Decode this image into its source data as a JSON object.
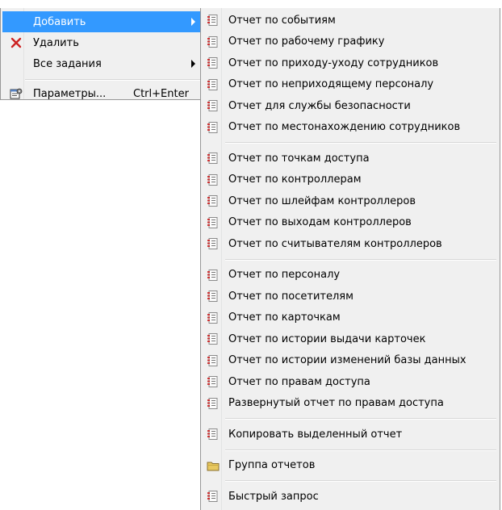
{
  "main_menu": {
    "items": [
      {
        "label": "Добавить",
        "shortcut": "",
        "has_submenu": true,
        "highlighted": true,
        "icon": ""
      },
      {
        "label": "Удалить",
        "shortcut": "",
        "has_submenu": false,
        "highlighted": false,
        "icon": "delete-x-icon"
      },
      {
        "label": "Все задания",
        "shortcut": "",
        "has_submenu": true,
        "highlighted": false,
        "icon": ""
      },
      {
        "label": "Параметры...",
        "shortcut": "Ctrl+Enter",
        "has_submenu": false,
        "highlighted": false,
        "icon": "properties-icon"
      }
    ]
  },
  "submenu": {
    "groups": [
      {
        "items": [
          {
            "label": "Отчет по событиям",
            "icon": "report-icon"
          },
          {
            "label": "Отчет по рабочему графику",
            "icon": "report-icon"
          },
          {
            "label": "Отчет по приходу-уходу сотрудников",
            "icon": "report-icon"
          },
          {
            "label": "Отчет по неприходящему персоналу",
            "icon": "report-icon"
          },
          {
            "label": "Отчет для службы безопасности",
            "icon": "report-icon"
          },
          {
            "label": "Отчет по местонахождению сотрудников",
            "icon": "report-icon"
          }
        ]
      },
      {
        "items": [
          {
            "label": "Отчет по точкам доступа",
            "icon": "report-icon"
          },
          {
            "label": "Отчет по контроллерам",
            "icon": "report-icon"
          },
          {
            "label": "Отчет по шлейфам контроллеров",
            "icon": "report-icon"
          },
          {
            "label": "Отчет по выходам контроллеров",
            "icon": "report-icon"
          },
          {
            "label": "Отчет по считывателям контроллеров",
            "icon": "report-icon"
          }
        ]
      },
      {
        "items": [
          {
            "label": "Отчет по персоналу",
            "icon": "report-icon"
          },
          {
            "label": "Отчет по посетителям",
            "icon": "report-icon"
          },
          {
            "label": "Отчет по карточкам",
            "icon": "report-icon"
          },
          {
            "label": "Отчет по истории выдачи карточек",
            "icon": "report-icon"
          },
          {
            "label": "Отчет по истории изменений базы данных",
            "icon": "report-icon"
          },
          {
            "label": "Отчет по правам доступа",
            "icon": "report-icon"
          },
          {
            "label": "Развернутый отчет по правам доступа",
            "icon": "report-icon"
          }
        ]
      },
      {
        "items": [
          {
            "label": "Копировать выделенный отчет",
            "icon": "report-icon"
          }
        ]
      },
      {
        "items": [
          {
            "label": "Группа отчетов",
            "icon": "folder-icon"
          }
        ]
      },
      {
        "items": [
          {
            "label": "Быстрый запрос",
            "icon": "report-icon"
          }
        ]
      }
    ]
  },
  "colors": {
    "highlight": "#3399ff",
    "menu_bg": "#f0f0f0",
    "delete_icon": "#cc2222",
    "report_icon_accent": "#cc3333",
    "folder_icon": "#e8c860"
  }
}
